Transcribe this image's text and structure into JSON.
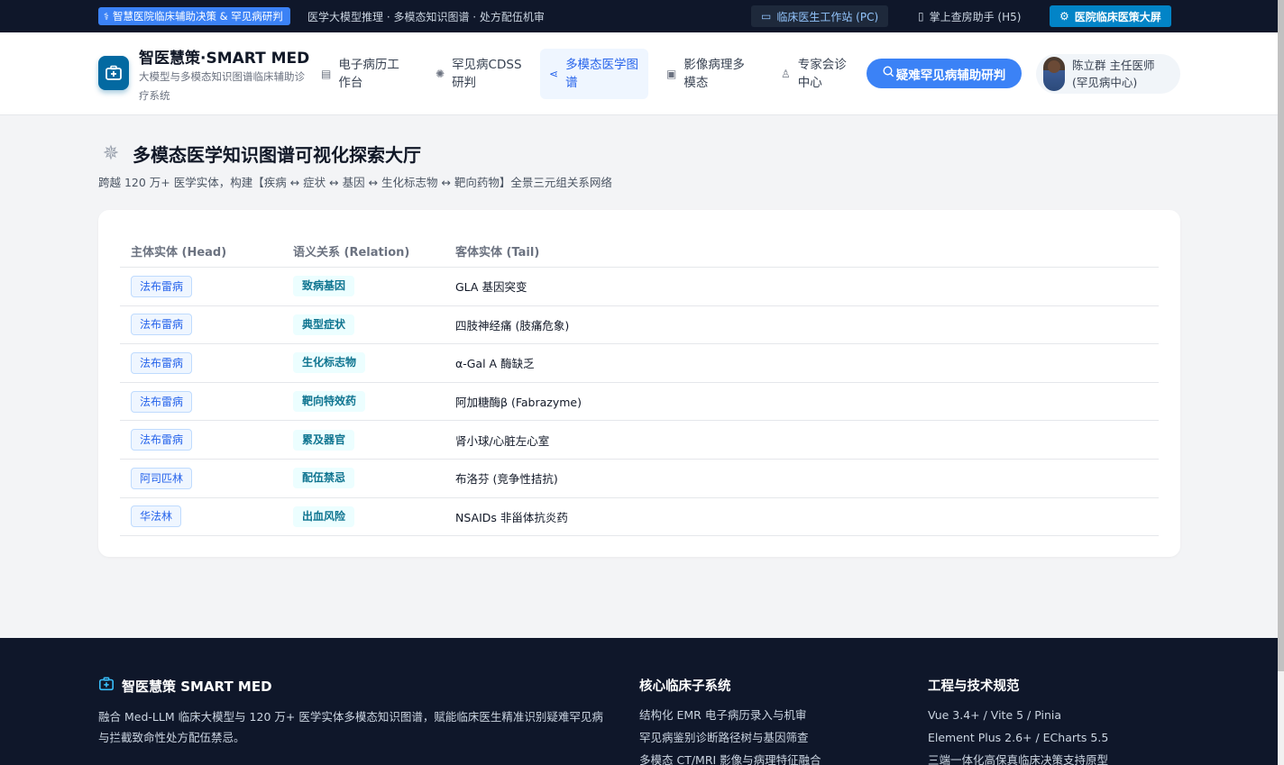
{
  "topbar": {
    "brand_label": "智慧医院临床辅助决策 & 罕见病研判",
    "subtitle": "医学大模型推理 · 多模态知识图谱 · 处方配伍机审",
    "env_pc": "临床医生工作站 (PC)",
    "env_h5": "掌上查房助手 (H5)",
    "env_screen": "医院临床医策大屏"
  },
  "header": {
    "logo_title": "智医慧策·SMART MED",
    "logo_subtitle": "大模型与多模态知识图谱临床辅助诊疗系统",
    "nav": [
      {
        "label": "电子病历工作台",
        "icon": "document-icon"
      },
      {
        "label": "罕见病CDSS研判",
        "icon": "gear-icon"
      },
      {
        "label": "多模态医学图谱",
        "icon": "share-icon",
        "active": true
      },
      {
        "label": "影像病理多模态",
        "icon": "image-icon"
      },
      {
        "label": "专家会诊中心",
        "icon": "user-icon"
      }
    ],
    "cta_label": "疑难罕见病辅助研判",
    "user_name": "陈立群 主任医师",
    "user_dept": "(罕见病中心)"
  },
  "page": {
    "title": "多模态医学知识图谱可视化探索大厅",
    "description": "跨越 120 万+ 医学实体，构建【疾病 ↔ 症状 ↔ 基因 ↔ 生化标志物 ↔ 靶向药物】全景三元组关系网络"
  },
  "table": {
    "columns": [
      "主体实体 (Head)",
      "语义关系 (Relation)",
      "客体实体 (Tail)"
    ],
    "rows": [
      {
        "head": "法布雷病",
        "relation": "致病基因",
        "tail": "GLA 基因突变"
      },
      {
        "head": "法布雷病",
        "relation": "典型症状",
        "tail": "四肢神经痛 (肢痛危象)"
      },
      {
        "head": "法布雷病",
        "relation": "生化标志物",
        "tail": "α-Gal A 酶缺乏"
      },
      {
        "head": "法布雷病",
        "relation": "靶向特效药",
        "tail": "阿加糖酶β (Fabrazyme)"
      },
      {
        "head": "法布雷病",
        "relation": "累及器官",
        "tail": "肾小球/心脏左心室"
      },
      {
        "head": "阿司匹林",
        "relation": "配伍禁忌",
        "tail": "布洛芬 (竞争性拮抗)"
      },
      {
        "head": "华法林",
        "relation": "出血风险",
        "tail": "NSAIDs 非甾体抗炎药"
      }
    ]
  },
  "footer": {
    "brand": "智医慧策 SMART MED",
    "description": "融合 Med-LLM 临床大模型与 120 万+ 医学实体多模态知识图谱，赋能临床医生精准识别疑难罕见病与拦截致命性处方配伍禁忌。",
    "col1_title": "核心临床子系统",
    "col1_items": [
      "结构化 EMR 电子病历录入与机审",
      "罕见病鉴别诊断路径树与基因筛查",
      "多模态 CT/MRI 影像与病理特征融合"
    ],
    "col2_title": "工程与技术规范",
    "col2_items": [
      "Vue 3.4+ / Vite 5 / Pinia",
      "Element Plus 2.6+ / ECharts 5.5",
      "三端一体化高保真临床决策支持原型"
    ]
  }
}
